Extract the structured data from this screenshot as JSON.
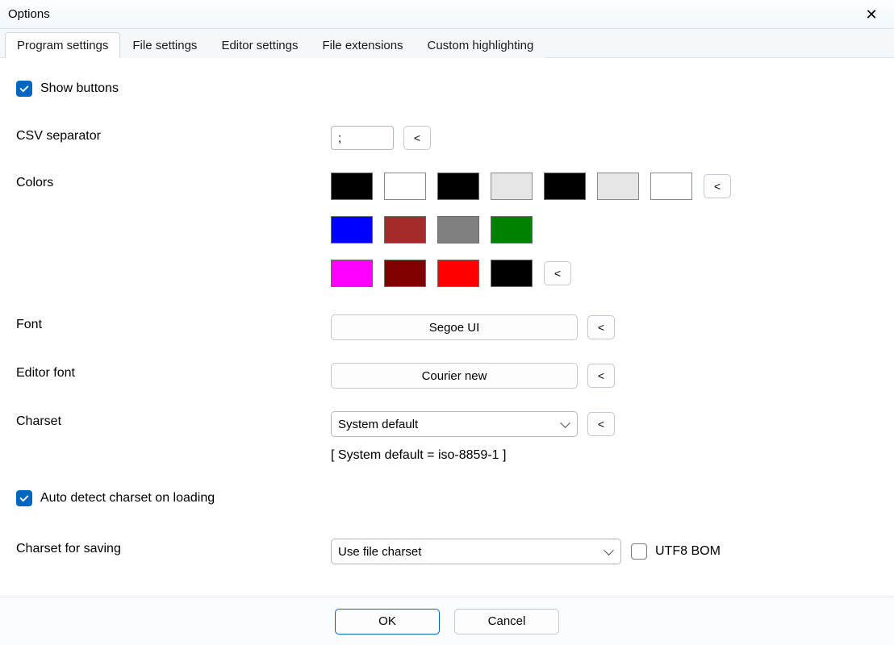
{
  "window": {
    "title": "Options",
    "close_icon": "✕"
  },
  "tabs": [
    {
      "label": "Program settings",
      "active": true
    },
    {
      "label": "File settings",
      "active": false
    },
    {
      "label": "Editor settings",
      "active": false
    },
    {
      "label": "File extensions",
      "active": false
    },
    {
      "label": "Custom highlighting",
      "active": false
    }
  ],
  "show_buttons": {
    "label": "Show buttons",
    "checked": true
  },
  "csv_separator": {
    "label": "CSV separator",
    "value": ";",
    "reset": "<"
  },
  "colors": {
    "label": "Colors",
    "reset_row1": "<",
    "reset_row3": "<",
    "rows": [
      [
        "#000000",
        "#ffffff",
        "#000000",
        "#e6e6e6",
        "#000000",
        "#e6e6e6",
        "#ffffff"
      ],
      [
        "#0000ff",
        "#a52a2a",
        "#808080",
        "#008000"
      ],
      [
        "#ff00ff",
        "#800000",
        "#ff0000",
        "#000000"
      ]
    ]
  },
  "font": {
    "label": "Font",
    "value": "Segoe UI",
    "reset": "<"
  },
  "editor_font": {
    "label": "Editor font",
    "value": "Courier new",
    "reset": "<"
  },
  "charset": {
    "label": "Charset",
    "value": "System default",
    "reset": "<",
    "info": "[ System default = iso-8859-1 ]"
  },
  "auto_detect": {
    "label": "Auto detect charset on loading",
    "checked": true
  },
  "charset_saving": {
    "label": "Charset for saving",
    "value": "Use file charset",
    "utf8bom_label": "UTF8 BOM",
    "utf8bom_checked": false
  },
  "footer": {
    "ok": "OK",
    "cancel": "Cancel"
  }
}
